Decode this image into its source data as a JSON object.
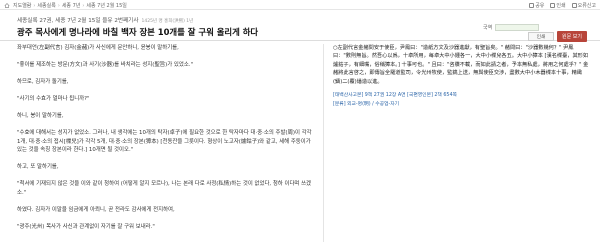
{
  "topbar": {
    "breadcrumb": [
      "지도열람",
      "세종실록",
      "세종 7년",
      "세종 7년 2월 15일"
    ],
    "right_items": [
      "공유",
      "인쇄",
      "오류신고"
    ]
  },
  "article": {
    "meta": "세종실록 27권, 세종 7년 2월 15일 을유 2번째기사",
    "meta_sub": "1425년 명 홍희(洪熙) 1년",
    "title": "광주 목사에게 명나라에 바칠 백자 장본 10개를 잘 구워 올리게 하다"
  },
  "controls": {
    "lang_label": "국역",
    "print_label": "인쇄",
    "view_label": "원문 보기"
  },
  "left_paragraphs": [
    "좌부대언(左副代言) 김자(金赭)가 사신에게 문안하니, 윤봉이 말하기를,",
    "\"좋이를 제조하는 방문(方文)과 사기(沙器)를 바치라는 성지(聖旨)가 있었소.\"",
    "하므로, 김자가 돌기를,",
    "\"사기의 수효가 얼마나 됩니까?\"",
    "하니, 봉이 말하기를,",
    "\"수효에 대해서는 성지가 없었소. 그러나, 내 생각에는 10개의 탁자(卓子)에 필요한 것으로 한 탁자마다 대·중·소의 주발(周)이 각각 1개, 대·중·소의 접시[楪兒]가 각각 5개, 대·중·소의 장본(獐本) [천동잔을 그릇이다. 형상이 노고자(爐鈷子)와 같고, 세해 주둥이가 있는 것을 속칭 장본이라 한다.] 10개면 될 것이오.\"",
    "하고, 또 말하기를,",
    "\"척서에 기재되지 않은 것을 이와 같이 청하여 (어떻게 알지 모르나), 나는 본래 다로 사정(私情)하는 것이 없었다, 청하 이다며 쓰겠소.\"",
    "하였다. 김자가 이말을 임금에게 아뢰니, 곧 전라도 감사에게 전지하여,",
    "\"광주(光州) 목사가 사신과 관계없이 자기를 잘 구워 보내라.\""
  ],
  "original_text": "○左副代言金赭問安于使臣，尹鳳曰：\"造紙方文及沙器進獻，有聖旨矣。\" 赭問曰：\"沙器數幾何？\" 尹鳳曰：\"數則無旨。然吾心以爲，十卓所用，每卓大中小鍾各一，大中小楪兒各五。大中小獐本 [漢名楪臺，其形如爐鈷子，有細嘴，俗稱獐本。] 十事可也。\" 且曰：\"咨牒不載，而如此請之者，予本無私處，將用之何處乎？\" 金赭將此言啓之，即傳旨全羅道監司，令光州牧使，監鐫上送，無與使臣交涉，盡數大中小木器楪本十事，精緻(鑄)二(覆)燔造以進。",
  "references": {
    "line1": "[태백산사고본] 9책 27권 12장 A면 [국편영인본] 2책 654쪽",
    "line2": "[분류] 외교-명(明) / 수공업-자기"
  }
}
